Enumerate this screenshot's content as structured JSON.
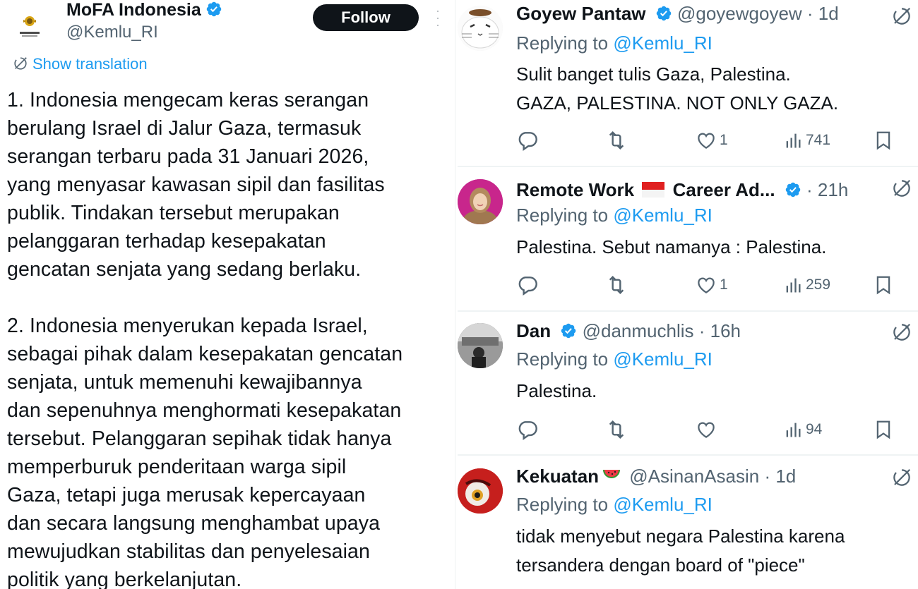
{
  "post": {
    "author_name": "MoFA Indonesia",
    "author_handle": "@Kemlu_RI",
    "follow_label": "Follow",
    "show_translation": "Show translation",
    "text": "1. Indonesia mengecam keras serangan\nberulang Israel di Jalur Gaza, termasuk\nserangan terbaru pada 31 Januari 2026,\nyang menyasar kawasan sipil dan fasilitas\npublik. Tindakan tersebut merupakan\npelanggaran terhadap kesepakatan\ngencatan senjata yang sedang berlaku.\n\n2. Indonesia menyerukan kepada Israel,\nsebagai pihak dalam kesepakatan gencatan\nsenjata, untuk memenuhi kewajibannya\ndan sepenuhnya menghormati kesepakatan\ntersebut. Pelanggaran sepihak tidak hanya\nmemperburuk penderitaan warga sipil\nGaza, tetapi juga merusak kepercayaan\ndan secara langsung menghambat upaya\nmewujudkan stabilitas dan penyelesaian\npolitik yang berkelanjutan."
  },
  "replies": [
    {
      "name": "Goyew Pantaw",
      "handle": "@goyewgoyew",
      "time": "· 1d",
      "replying_prefix": "Replying to ",
      "replying_to": "@Kemlu_RI",
      "text": "Sulit banget tulis Gaza, Palestina.\nGAZA, PALESTINA. NOT ONLY GAZA.",
      "likes": "1",
      "views": "741"
    },
    {
      "name_part1": "Remote Work",
      "name_part2": "Career Ad...",
      "handle": "",
      "time": "· 21h",
      "replying_prefix": "Replying to ",
      "replying_to": "@Kemlu_RI",
      "text": "Palestina. Sebut namanya : Palestina.",
      "likes": "1",
      "views": "259"
    },
    {
      "name": "Dan",
      "handle": "@danmuchlis",
      "time": "· 16h",
      "replying_prefix": "Replying to ",
      "replying_to": "@Kemlu_RI",
      "text": "Palestina.",
      "likes": "",
      "views": "94"
    },
    {
      "name": "Kekuatan",
      "handle": "@AsinanAsasin",
      "time": "· 1d",
      "replying_prefix": "Replying to ",
      "replying_to": "@Kemlu_RI",
      "text": "tidak menyebut negara Palestina karena\ntersandera dengan board of \"piece\""
    }
  ],
  "colors": {
    "accent": "#1d9bf0",
    "text": "#0f1419",
    "muted": "#536471",
    "divider": "#eff3f4"
  },
  "icons": [
    "verified-badge-icon",
    "grok-icon",
    "reply-icon",
    "repost-icon",
    "like-icon",
    "views-icon",
    "bookmark-icon",
    "watermelon-emoji",
    "indonesia-flag-emoji"
  ]
}
